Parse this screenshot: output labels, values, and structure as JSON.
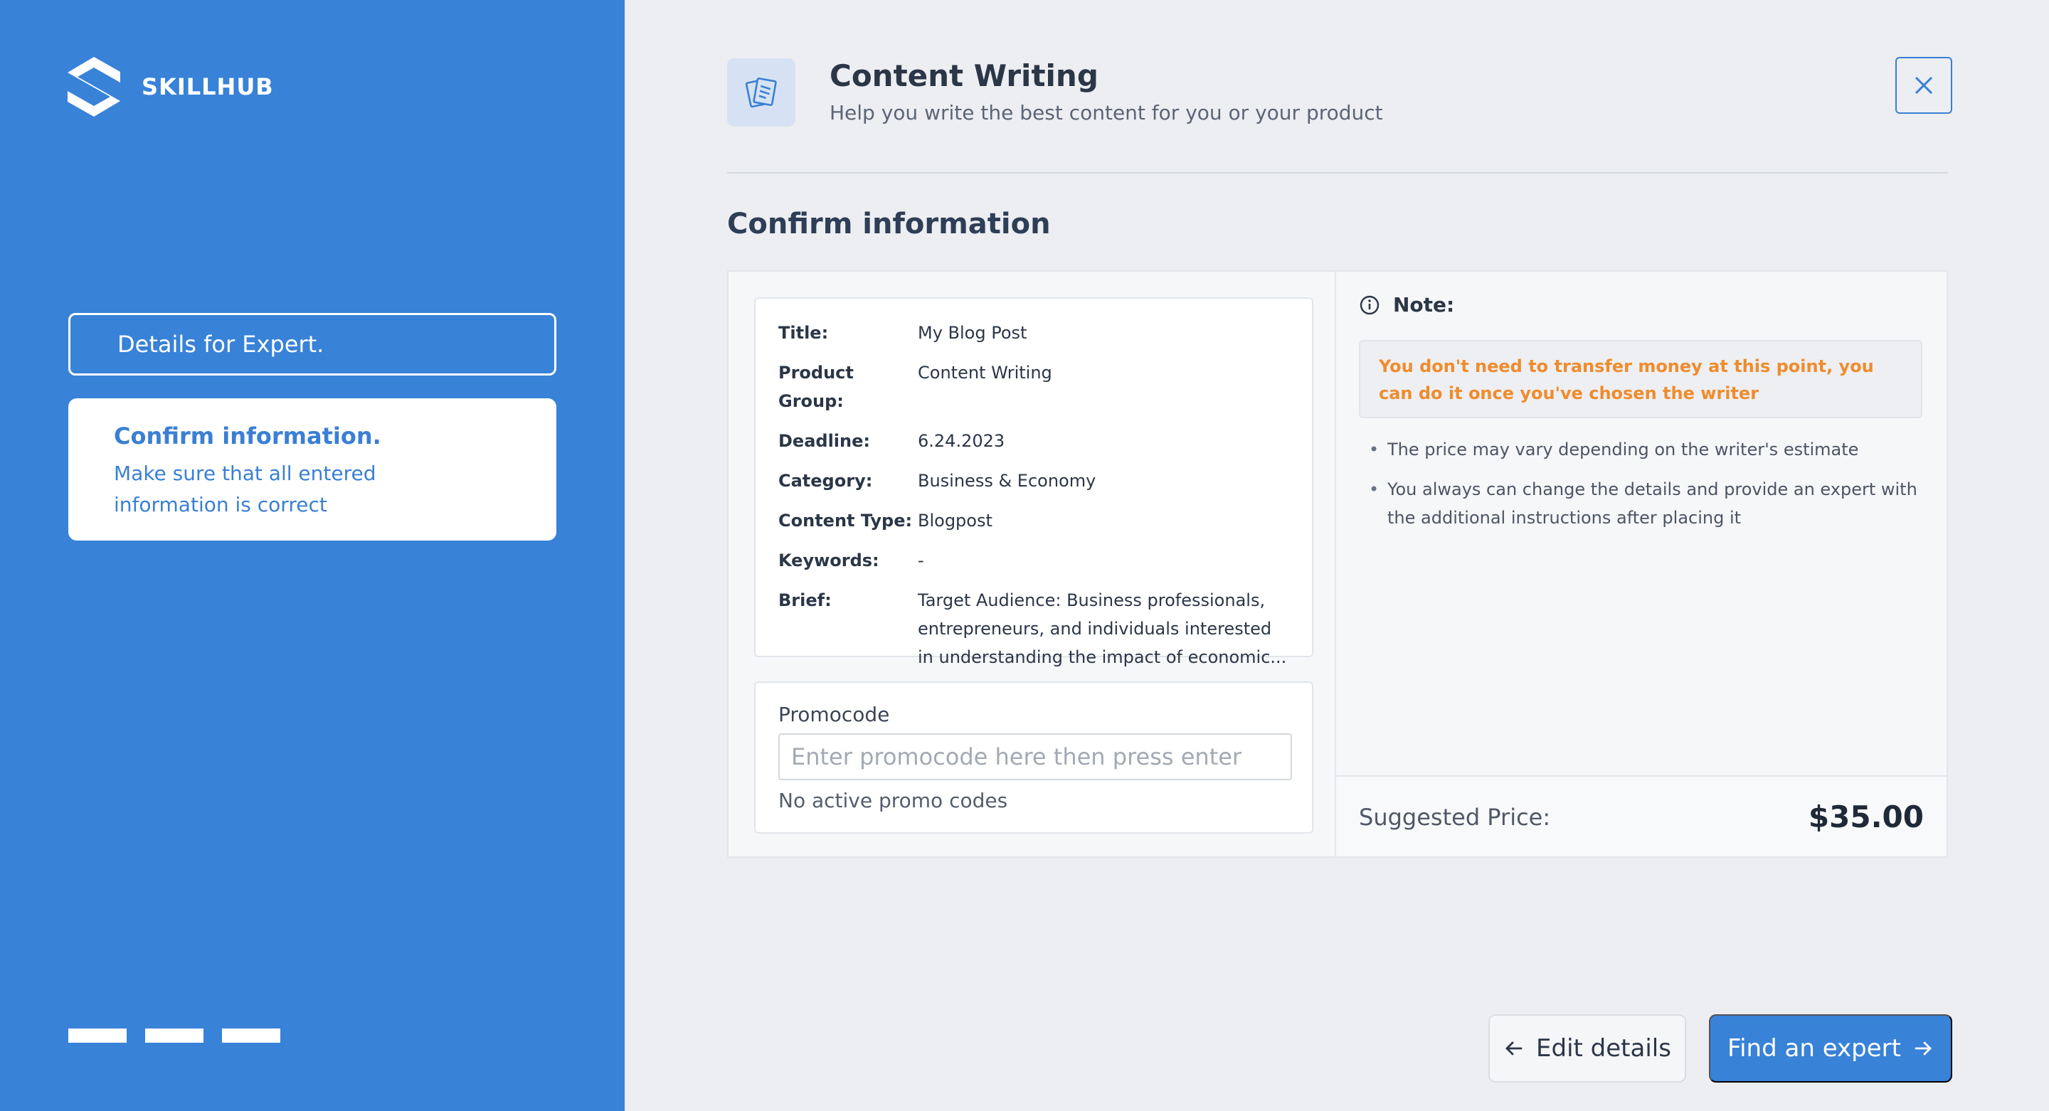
{
  "brand": {
    "name": "SKILLHUB"
  },
  "colors": {
    "accent": "#3882d8",
    "warning": "#ef8c2d",
    "sidebar": "#3882d8"
  },
  "steps": [
    {
      "title": "Details for Expert.",
      "state": "inactive"
    },
    {
      "title": "Confirm information.",
      "description": "Make sure that all entered information is correct",
      "state": "active"
    }
  ],
  "header": {
    "icon": "documents-icon",
    "title": "Content Writing",
    "subtitle": "Help you write the best content for you or your product"
  },
  "section_title": "Confirm information",
  "details": [
    {
      "label": "Title:",
      "value": "My Blog Post"
    },
    {
      "label": "Product Group:",
      "value": "Content Writing"
    },
    {
      "label": "Deadline:",
      "value": "6.24.2023"
    },
    {
      "label": "Category:",
      "value": "Business & Economy"
    },
    {
      "label": "Content Type:",
      "value": "Blogpost"
    },
    {
      "label": "Keywords:",
      "value": "-"
    },
    {
      "label": "Brief:",
      "value": "Target Audience: Business professionals, entrepreneurs, and individuals interested in understanding the impact of economic..."
    }
  ],
  "promo": {
    "label": "Promocode",
    "placeholder": "Enter promocode here then press enter",
    "value": "",
    "status": "No active promo codes"
  },
  "note": {
    "heading": "Note:",
    "warning": "You don't need to transfer money at this point, you can do it once you've chosen the writer",
    "items": [
      "The price may vary depending on the writer's estimate",
      "You always can change the details and provide an expert with the additional instructions after placing it"
    ]
  },
  "price": {
    "label": "Suggested Price:",
    "value": "$35.00"
  },
  "actions": {
    "edit_label": "Edit details",
    "find_label": "Find an expert"
  }
}
